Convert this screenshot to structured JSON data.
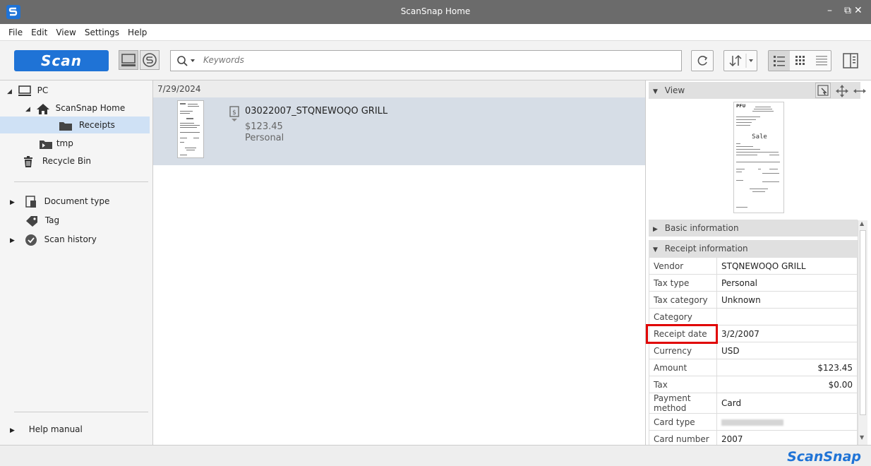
{
  "window": {
    "title": "ScanSnap Home",
    "controls": {
      "minimize": "–",
      "restore": "⧉",
      "close": "✕"
    }
  },
  "menu": [
    "File",
    "Edit",
    "View",
    "Settings",
    "Help"
  ],
  "toolbar": {
    "scan_label": "Scan",
    "search_placeholder": "Keywords"
  },
  "sidebar": {
    "tree": {
      "pc": "PC",
      "scansnap_home": "ScanSnap Home",
      "receipts": "Receipts",
      "tmp": "tmp",
      "recycle_bin": "Recycle Bin"
    },
    "filters": [
      "Document type",
      "Tag",
      "Scan history"
    ],
    "help": "Help manual"
  },
  "list": {
    "date_header": "7/29/2024",
    "document": {
      "name": "03022007_STQNEWOQO GRILL",
      "amount": "$123.45",
      "tax_type": "Personal"
    }
  },
  "right": {
    "view_header": "View",
    "basic_header": "Basic information",
    "receipt_header": "Receipt information",
    "receipt_fields": [
      {
        "key": "Vendor",
        "value": "STQNEWOQO GRILL"
      },
      {
        "key": "Tax type",
        "value": "Personal"
      },
      {
        "key": "Tax category",
        "value": "Unknown"
      },
      {
        "key": "Category",
        "value": ""
      },
      {
        "key": "Receipt date",
        "value": "3/2/2007"
      },
      {
        "key": "Currency",
        "value": "USD"
      },
      {
        "key": "Amount",
        "value": "$123.45"
      },
      {
        "key": "Tax",
        "value": "$0.00"
      },
      {
        "key": "Payment method",
        "value": "Card"
      },
      {
        "key": "Card type",
        "value": ""
      },
      {
        "key": "Card number",
        "value": "2007"
      }
    ]
  },
  "receipt_preview": {
    "brand": "PFU",
    "sale": "Sale"
  },
  "status": {
    "logo": "ScanSnap"
  },
  "colors": {
    "accent": "#1f73d6",
    "highlight": "#e00000"
  }
}
